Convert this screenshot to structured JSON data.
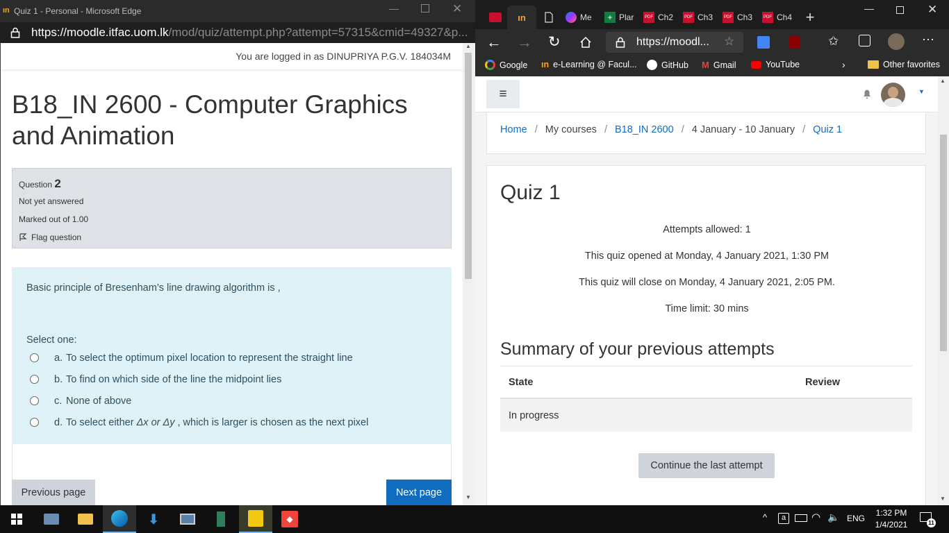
{
  "left_window": {
    "title": "Quiz 1 - Personal - Microsoft Edge",
    "url_host": "https://moodle.itfac.uom.lk",
    "url_path": "/mod/quiz/attempt.php?attempt=57315&cmid=49327&p...",
    "logged_in_text": "You are logged in as DINUPRIYA P.G.V. 184034M",
    "course_title": "B18_IN 2600 - Computer Graphics and Animation",
    "question_info": {
      "label": "Question",
      "number": "2",
      "status": "Not yet answered",
      "marks": "Marked out of 1.00",
      "flag": "Flag question"
    },
    "question_text": "Basic principle of Bresenham’s line drawing algorithm is ,",
    "select_one": "Select one:",
    "options": [
      {
        "letter": "a.",
        "text": "To select the optimum pixel location to represent the straight line"
      },
      {
        "letter": "b.",
        "text": "To find on which side of the line the midpoint lies"
      },
      {
        "letter": "c.",
        "text": "None of above"
      },
      {
        "letter": "d.",
        "text_pre": "To select either ",
        "text_math": "Δx or Δy",
        "text_post": " , which is larger is chosen as the next pixel"
      }
    ],
    "prev_button": "Previous page",
    "next_button": "Next page"
  },
  "right_window": {
    "tabs": [
      "",
      "",
      "",
      "Me",
      "Plar",
      "Ch2",
      "Ch3",
      "Ch3",
      "Ch4"
    ],
    "url": "https://moodl...",
    "favorites": [
      "Google",
      "e-Learning @ Facul...",
      "GitHub",
      "Gmail",
      "YouTube"
    ],
    "other_favorites": "Other favorites",
    "breadcrumb": [
      "Home",
      "My courses",
      "B18_IN 2600",
      "4 January - 10 January",
      "Quiz 1"
    ],
    "quiz_title": "Quiz 1",
    "attempts_allowed": "Attempts allowed: 1",
    "opened": "This quiz opened at Monday, 4 January 2021, 1:30 PM",
    "closes": "This quiz will close on Monday, 4 January 2021, 2:05 PM.",
    "time_limit": "Time limit: 30 mins",
    "summary_title": "Summary of your previous attempts",
    "table_headers": [
      "State",
      "Review"
    ],
    "table_rows": [
      {
        "state": "In progress",
        "review": ""
      }
    ],
    "continue_button": "Continue the last attempt"
  },
  "taskbar": {
    "language": "ENG",
    "time": "1:32 PM",
    "date": "1/4/2021",
    "notification_count": "11"
  },
  "colors": {
    "moodle_blue": "#0f6cbf",
    "question_bg": "#def2f8",
    "info_bg": "#dee2e6"
  }
}
